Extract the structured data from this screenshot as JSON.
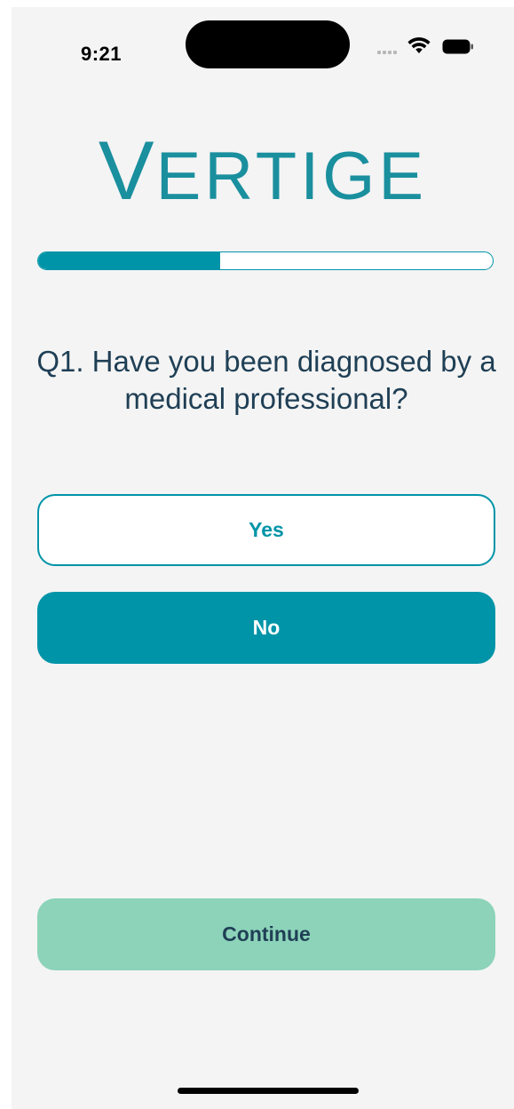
{
  "status_bar": {
    "time": "9:21",
    "icons": [
      "signal-icon",
      "wifi-icon",
      "battery-icon"
    ]
  },
  "logo": {
    "first_letter": "V",
    "rest": "ERTIGE"
  },
  "progress": {
    "fraction": 0.4
  },
  "question": {
    "text": "Q1. Have you been diagnosed by a medical professional?"
  },
  "options": [
    {
      "label": "Yes",
      "selected": false
    },
    {
      "label": "No",
      "selected": true
    }
  ],
  "continue_label": "Continue",
  "colors": {
    "accent": "#0094a8",
    "question_text": "#1f3f55",
    "continue_bg": "#8cd3b9",
    "background": "#f4f4f4"
  }
}
